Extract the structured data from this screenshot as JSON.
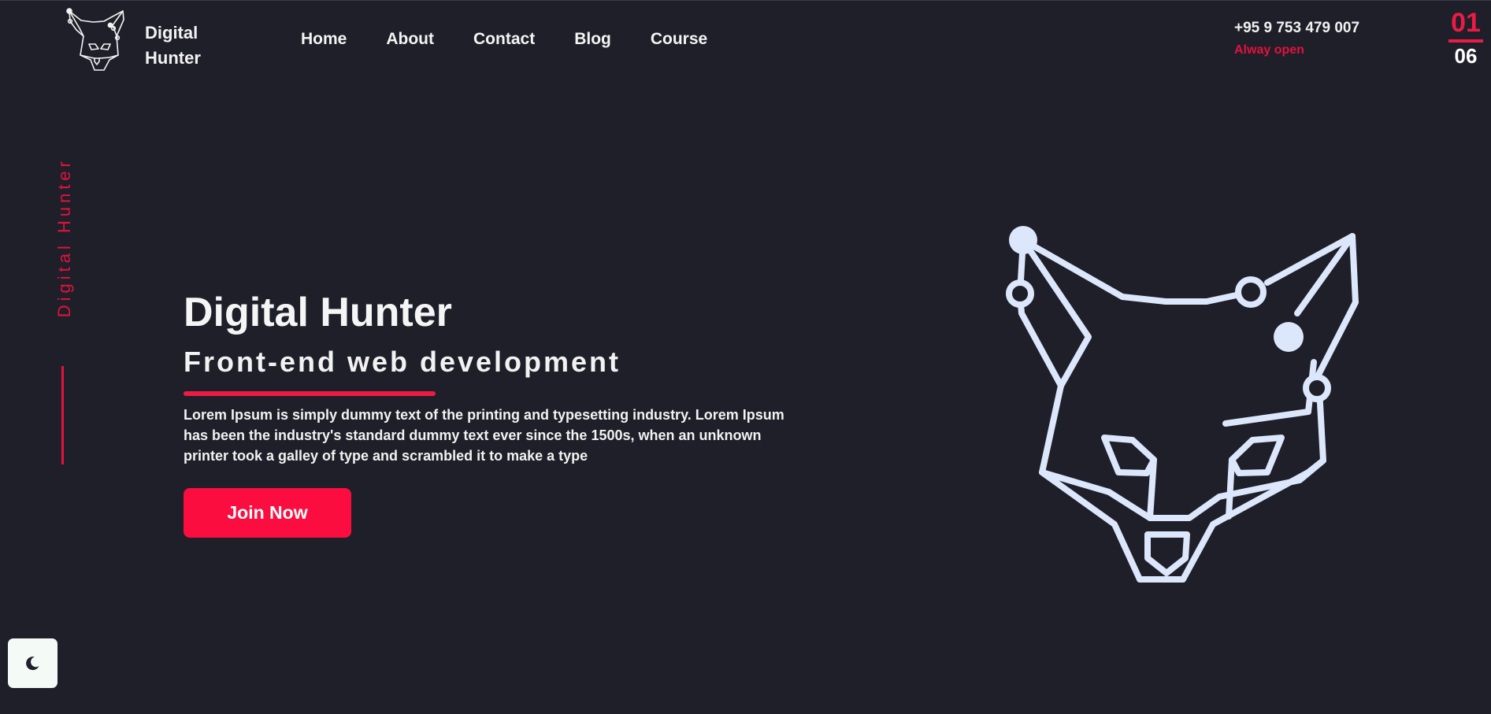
{
  "header": {
    "brand_line1": "Digital",
    "brand_line2": "Hunter",
    "nav": [
      {
        "label": "Home"
      },
      {
        "label": "About"
      },
      {
        "label": "Contact"
      },
      {
        "label": "Blog"
      },
      {
        "label": "Course"
      }
    ],
    "phone": "+95 9 753 479 007",
    "hours": "Alway open"
  },
  "pager": {
    "current": "01",
    "total": "06"
  },
  "side": {
    "label": "Digital Hunter"
  },
  "hero": {
    "title": "Digital Hunter",
    "subtitle": "Front-end web development",
    "description": "Lorem Ipsum is simply dummy text of the printing and typesetting industry. Lorem Ipsum has been the industry's standard dummy text ever since the 1500s, when an unknown printer took a galley of type and scrambled it to make a type",
    "button_label": "Join Now"
  },
  "icons": {
    "logo": "fox-logo-icon",
    "illustration": "fox-head-icon",
    "theme_toggle": "moon-icon"
  },
  "colors": {
    "background": "#1f1f2a",
    "accent": "#ec1b45",
    "button": "#fc0d3f",
    "fox_stroke": "#dce7fb",
    "toggle_bg": "#f4faf6"
  }
}
